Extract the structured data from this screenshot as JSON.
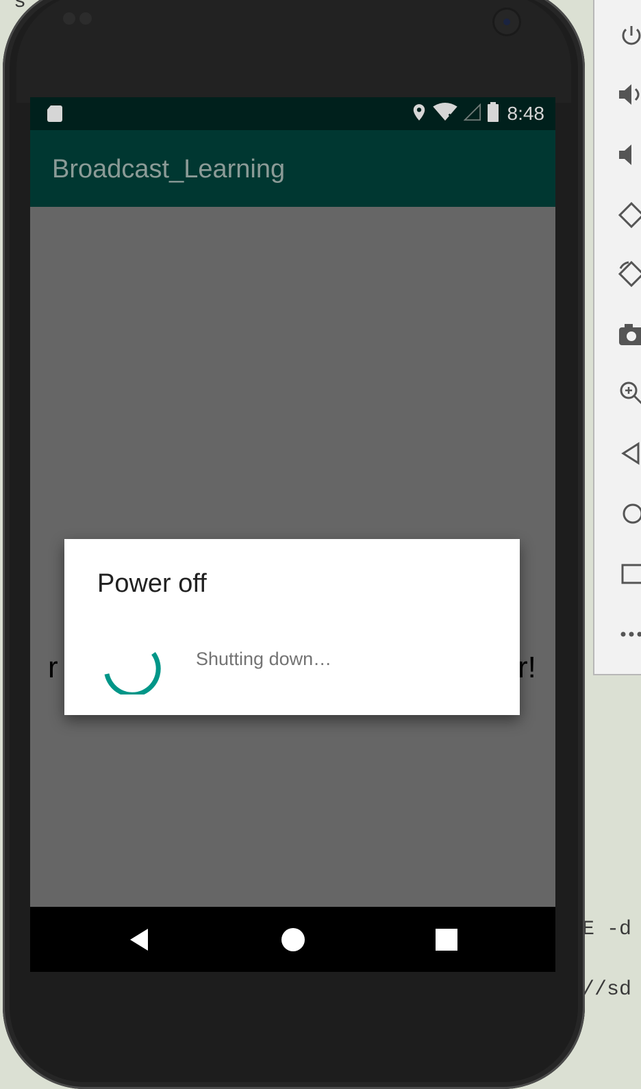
{
  "background": {
    "code_fragments": [
      "s",
      "E -d",
      "//sd"
    ]
  },
  "emulator_toolbar": {
    "buttons": [
      "power-icon",
      "volume-up-icon",
      "volume-down-icon",
      "rotate-left-icon",
      "rotate-right-icon",
      "camera-icon",
      "zoom-icon",
      "back-icon",
      "home-icon",
      "overview-icon",
      "more-icon"
    ]
  },
  "status_bar": {
    "time": "8:48",
    "icons": [
      "sd-card-icon",
      "location-icon",
      "wifi-icon",
      "cell-signal-icon",
      "battery-icon"
    ]
  },
  "app_bar": {
    "title": "Broadcast_Learning"
  },
  "content": {
    "text_left": "r",
    "text_right": "r!"
  },
  "dialog": {
    "title": "Power off",
    "message": "Shutting down…"
  },
  "colors": {
    "status_bar": "#00201c",
    "app_bar": "#003731",
    "accent": "#009688",
    "scrim": "#666666"
  }
}
